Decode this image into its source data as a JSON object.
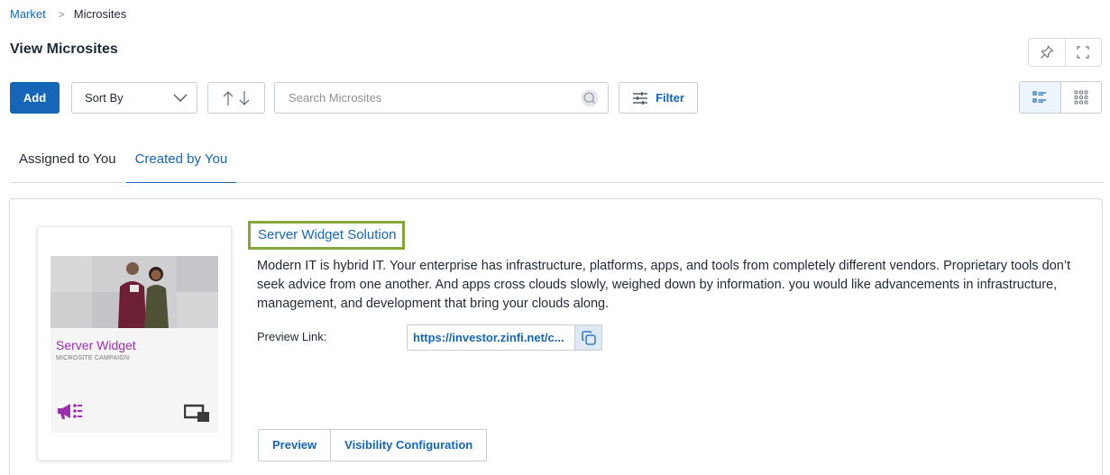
{
  "breadcrumb": {
    "parent": "Market",
    "separator": ">",
    "current": "Microsites"
  },
  "page": {
    "title": "View Microsites"
  },
  "toolbar": {
    "add_label": "Add",
    "sort_label": "Sort By",
    "search_placeholder": "Search Microsites",
    "search_value": "",
    "filter_label": "Filter"
  },
  "tabs": [
    {
      "label": "Assigned to You",
      "active": false
    },
    {
      "label": "Created by You",
      "active": true
    }
  ],
  "card": {
    "title": "Server Widget Solution",
    "description": "Modern IT is hybrid IT. Your enterprise has infrastructure, platforms, apps, and tools from completely different vendors. Proprietary tools don’t seek advice from one another. And apps cross clouds slowly, weighed down by information. you would like advancements in infrastructure, management, and development that bring your clouds along.",
    "preview_label": "Preview Link:",
    "preview_link": "https://investor.zinfi.net/c...",
    "thumbnail": {
      "title": "Server Widget",
      "subtitle": "MICROSITE CAMPAIGN"
    },
    "actions": {
      "preview": "Preview",
      "visibility": "Visibility Configuration"
    }
  },
  "icons": [
    "pin-icon",
    "fullscreen-icon",
    "chevron-down-icon",
    "sort-up-icon",
    "sort-down-icon",
    "search-icon",
    "filter-sliders-icon",
    "list-view-icon",
    "grid-view-icon",
    "copy-icon",
    "megaphone-icon",
    "screens-icon"
  ],
  "colors": {
    "primary": "#1565b8",
    "highlight_border": "#86a83a",
    "thumbnail_accent": "#9b2fae"
  }
}
